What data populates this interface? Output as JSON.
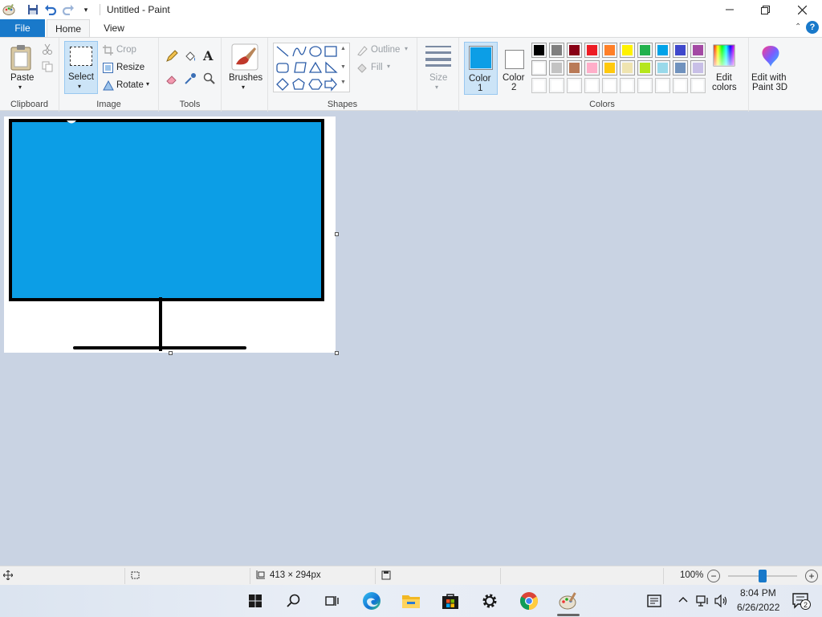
{
  "window": {
    "title": "Untitled - Paint"
  },
  "tabs": {
    "file": "File",
    "home": "Home",
    "view": "View"
  },
  "clipboard": {
    "paste": "Paste",
    "group": "Clipboard"
  },
  "image": {
    "select": "Select",
    "crop": "Crop",
    "resize": "Resize",
    "rotate": "Rotate",
    "group": "Image"
  },
  "tools": {
    "group": "Tools"
  },
  "brushes": {
    "label": "Brushes"
  },
  "shapes": {
    "outline": "Outline",
    "fill": "Fill",
    "group": "Shapes"
  },
  "size": {
    "label": "Size"
  },
  "colors": {
    "color1_label": "Color",
    "color1_num": "1",
    "color2_label": "Color",
    "color2_num": "2",
    "color1_value": "#0c9ee6",
    "color2_value": "#ffffff",
    "edit_colors_line1": "Edit",
    "edit_colors_line2": "colors",
    "paint3d_line1": "Edit with",
    "paint3d_line2": "Paint 3D",
    "group": "Colors",
    "palette_row1": [
      "#000000",
      "#7f7f7f",
      "#880015",
      "#ed1c24",
      "#ff7f27",
      "#fff200",
      "#22b14c",
      "#00a2e8",
      "#3f48cc",
      "#a349a4"
    ],
    "palette_row2": [
      "#ffffff",
      "#c3c3c3",
      "#b97a57",
      "#ffaec9",
      "#ffc90e",
      "#efe4b0",
      "#b5e61d",
      "#99d9ea",
      "#7092be",
      "#c8bfe7"
    ],
    "palette_row3": [
      "#ffffff",
      "#ffffff",
      "#ffffff",
      "#ffffff",
      "#ffffff",
      "#ffffff",
      "#ffffff",
      "#ffffff",
      "#ffffff",
      "#ffffff"
    ]
  },
  "status": {
    "canvas_size": "413 × 294px",
    "zoom": "100%",
    "zoom_level": 1.0
  },
  "taskbar": {
    "time": "8:04 PM",
    "date": "6/26/2022",
    "notification_count": "2"
  }
}
